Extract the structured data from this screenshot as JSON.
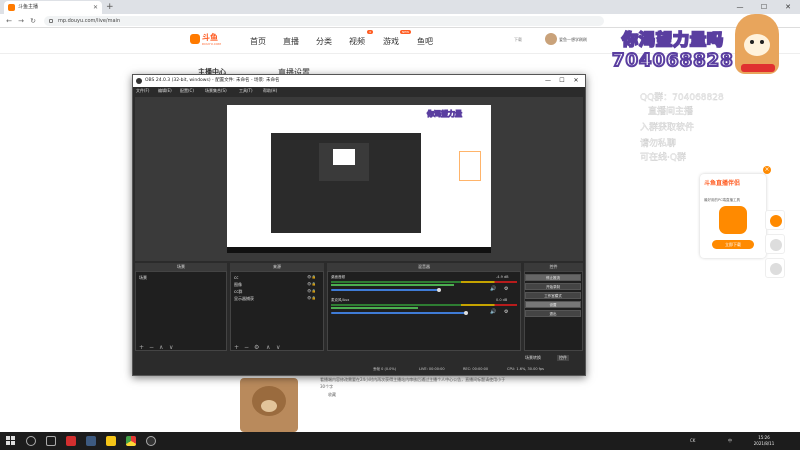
{
  "browser": {
    "tab_title": "斗鱼主播",
    "url": "mp.douyu.com/live/main",
    "new_tab": "+",
    "controls": {
      "minimize": "—",
      "maximize": "☐",
      "close": "✕"
    }
  },
  "site": {
    "logo": {
      "word": "斗鱼",
      "sub": "DOUYU.COM"
    },
    "nav": [
      "首页",
      "直播",
      "分类",
      "视频",
      "游戏",
      "鱼吧"
    ],
    "nav_badges": {
      "video": "4",
      "game": "NEW"
    },
    "header_right": {
      "download": "下载",
      "username": "爱鱼—想学刷刷"
    },
    "sidebar_title": "主播中心",
    "page_title": "直播设置",
    "lower_text": "看播端内容修改需要在24小时内再次获得主播站内审核后通过主播个人中心公告，直播间标题请使用小于30个字",
    "favorite": "收藏"
  },
  "overlay": {
    "line1": "你渴望力量吗",
    "line2": "704068828",
    "ghost_lines": [
      "QQ群：704068828",
      "直播间主播",
      "入群获取软件",
      "请勿私聊",
      "可在线·Q群"
    ]
  },
  "ad": {
    "title": "斗鱼直播伴侣",
    "desc": "最好用的PC端直播工具",
    "download": "立即下载",
    "close": "×"
  },
  "obs": {
    "title": "OBS 24.0.3 (32-bit, windows) - 配置文件: 未命名 - 场景: 未命名",
    "menu": [
      "文件(F)",
      "编辑(E)",
      "配置(C)",
      "场景集合(S)",
      "工具(T)",
      "帮助(H)"
    ],
    "preview_banner": "你渴望力量",
    "docks": {
      "scenes": {
        "title": "场景",
        "items": [
          "场景"
        ]
      },
      "sources": {
        "title": "来源",
        "items": [
          "cc",
          "图像",
          "cc群",
          "显示器捕获"
        ]
      },
      "mixer": {
        "title": "混音器",
        "channels": [
          {
            "label": "桌面音频",
            "db": "-4.9 dB",
            "level": 0.82,
            "volume": 0.72
          },
          {
            "label": "麦克风/Aux",
            "db": "0.0 dB",
            "level": 0.58,
            "volume": 0.9
          }
        ]
      },
      "controls": {
        "title": "控件",
        "buttons": [
          "停止推流",
          "开始录制",
          "工作室模式",
          "设置",
          "退出"
        ],
        "transition_tab": "场景转换",
        "controls_tab": "控件"
      }
    },
    "status": {
      "live": "LIVE: 00:00:00",
      "rec": "REC: 00:00:00",
      "cpu": "CPU: 1.6%, 30.00 fps",
      "dropped": "丢帧 0 (0.0%)"
    }
  },
  "taskbar": {
    "time": "15:26",
    "date": "2021/8/11",
    "tray": [
      "CK",
      "中"
    ]
  },
  "colors": {
    "brand_orange": "#ff7a00",
    "obs_bg": "#2b2b2b",
    "overlay_outline": "#5a3ea0"
  }
}
